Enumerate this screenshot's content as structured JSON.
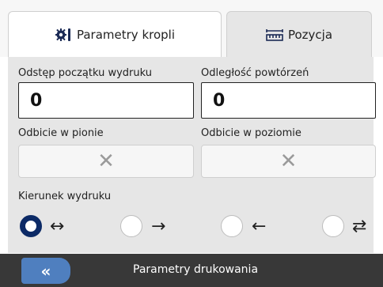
{
  "tabs": [
    {
      "label": "Parametry kropli",
      "icon": "gear-icon",
      "active": false
    },
    {
      "label": "Pozycja",
      "icon": "ruler-icon",
      "active": true
    }
  ],
  "fields": {
    "print_start_offset": {
      "label": "Odstęp początku wydruku",
      "value": "0"
    },
    "repeat_distance": {
      "label": "Odległość powtórzeń",
      "value": "0"
    },
    "vertical_flip": {
      "label": "Odbicie w pionie",
      "state_icon": "x-icon",
      "state_glyph": "✕"
    },
    "horizontal_flip": {
      "label": "Odbicie w poziomie",
      "state_icon": "x-icon",
      "state_glyph": "✕"
    }
  },
  "print_direction": {
    "label": "Kierunek wydruku",
    "options": [
      {
        "glyph": "↔",
        "icon": "bidirectional-arrow-icon",
        "selected": true
      },
      {
        "glyph": "→",
        "icon": "right-arrow-icon",
        "selected": false
      },
      {
        "glyph": "←",
        "icon": "left-arrow-icon",
        "selected": false
      },
      {
        "glyph": "⇄",
        "icon": "alternating-arrows-icon",
        "selected": false
      }
    ]
  },
  "bottom_bar": {
    "back_glyph": "«",
    "title": "Parametry drukowania"
  },
  "colors": {
    "accent_dark_blue": "#0c2a66",
    "back_button_blue": "#4f7fbf",
    "bottom_bar_bg": "#383838",
    "panel_bg": "#e6e6e6"
  }
}
